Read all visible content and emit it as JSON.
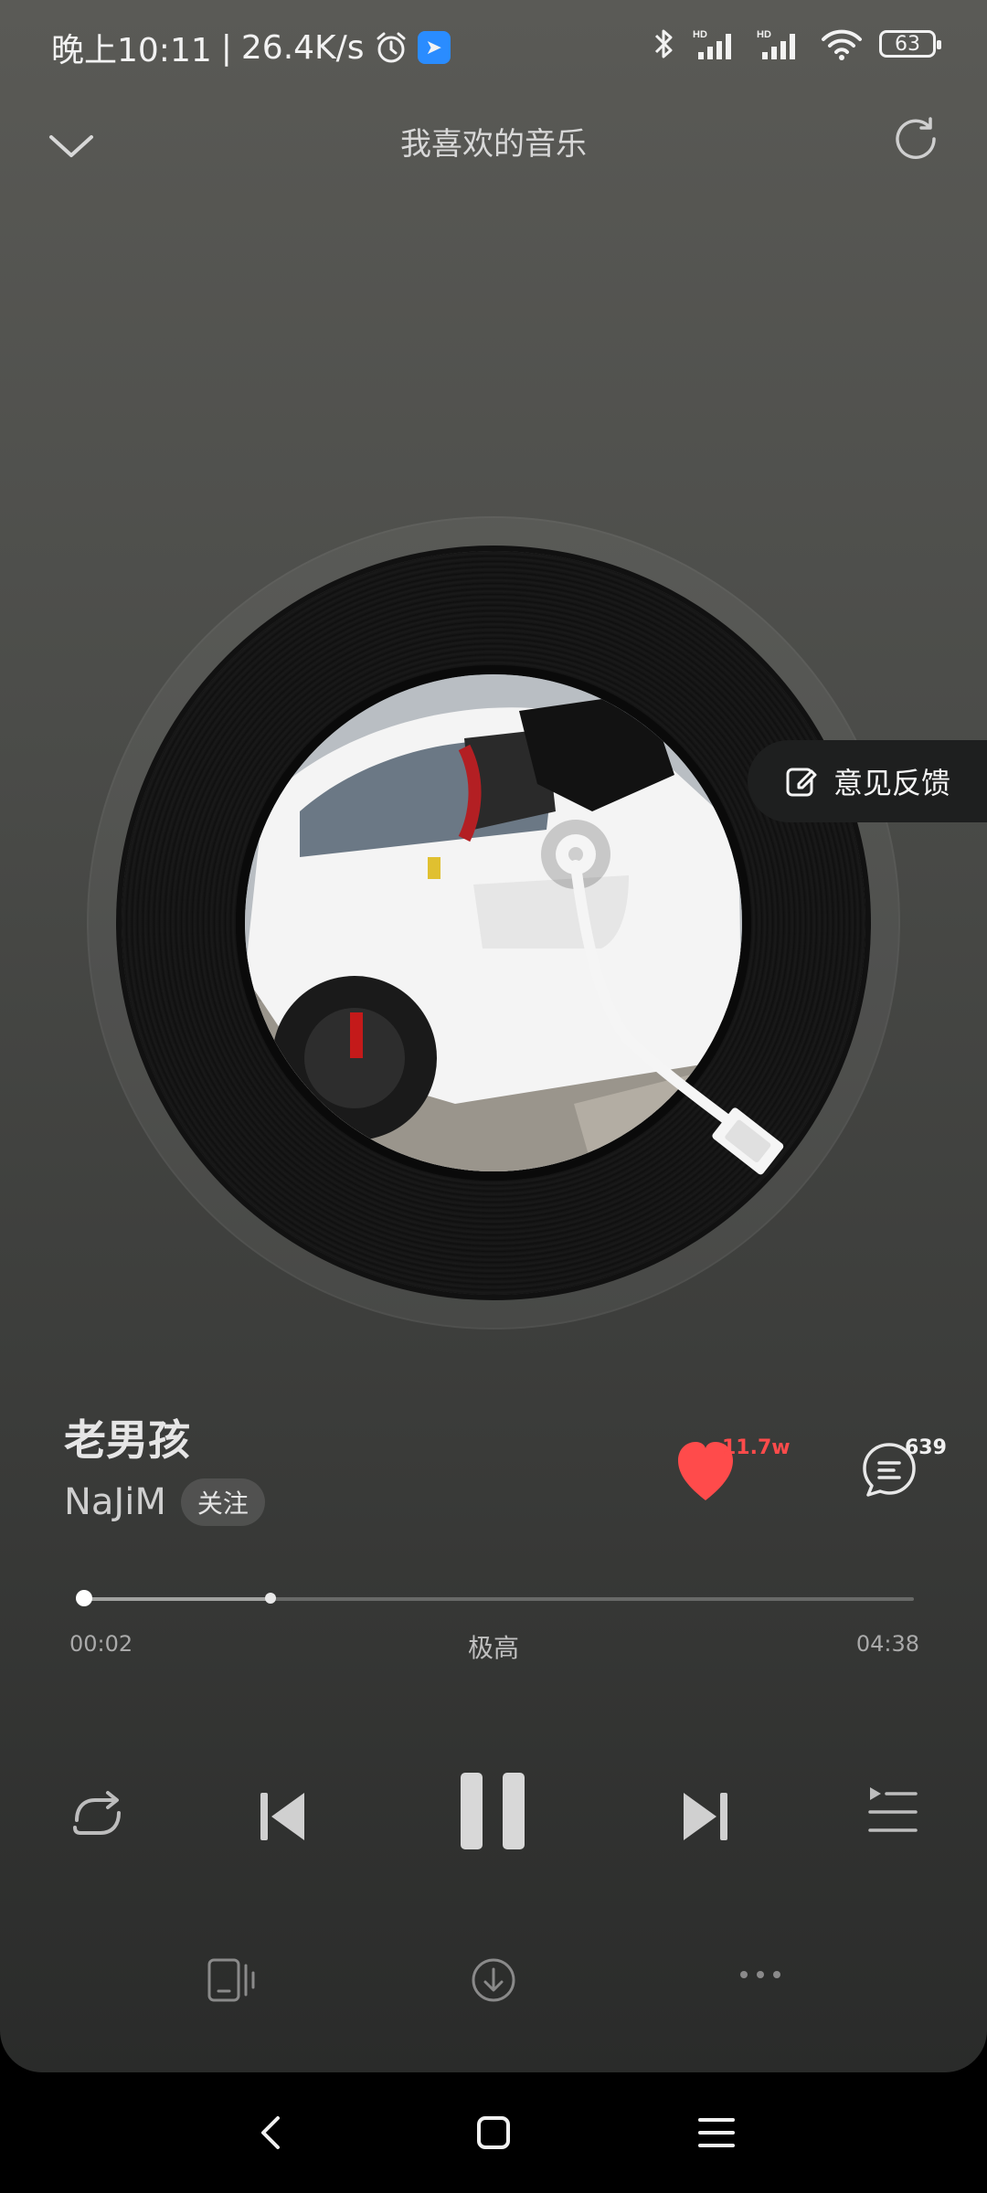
{
  "status_bar": {
    "time": "晚上10:11",
    "separator": "|",
    "network_speed": "26.4K/s",
    "battery": "63",
    "alarm_icon": "alarm-clock-icon",
    "app_icon": "app-notification-icon",
    "bluetooth_icon": "bluetooth-icon",
    "signal_icon": "cell-signal-icon",
    "wifi_icon": "wifi-icon"
  },
  "header": {
    "title": "我喜欢的音乐",
    "back_icon": "chevron-down-icon",
    "refresh_icon": "refresh-icon"
  },
  "feedback": {
    "label": "意见反馈",
    "icon": "edit-icon"
  },
  "song": {
    "title": "老男孩",
    "artist": "NaJiM",
    "follow_label": "关注",
    "like_count": "11.7w",
    "comment_count": "639"
  },
  "progress": {
    "elapsed": "00:02",
    "duration": "04:38",
    "quality": "极高",
    "played_fraction": 0.007,
    "buffered_fraction": 0.23
  },
  "controls": {
    "repeat_icon": "repeat-icon",
    "prev_icon": "skip-previous-icon",
    "pause_icon": "pause-icon",
    "next_icon": "skip-next-icon",
    "playlist_icon": "playlist-icon"
  },
  "tools": {
    "device_icon": "device-switch-icon",
    "download_icon": "download-icon",
    "more_icon": "more-icon"
  },
  "colors": {
    "accent_like": "#ff4b4b",
    "background_top": "#5a5a56",
    "background_bottom": "#2a2b2a"
  }
}
